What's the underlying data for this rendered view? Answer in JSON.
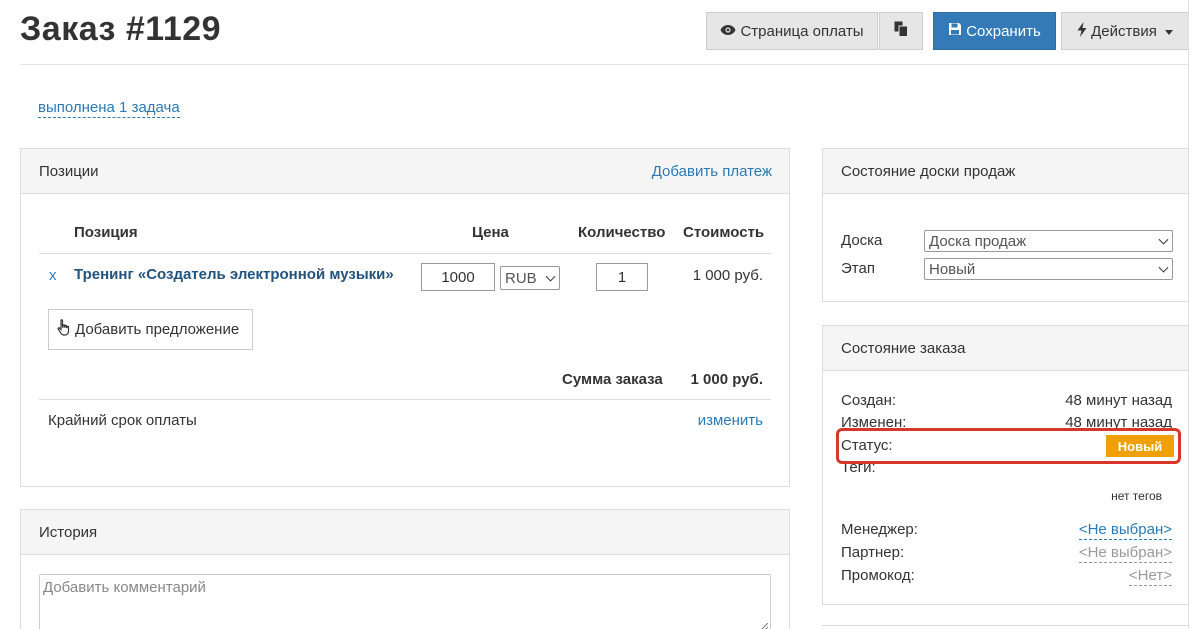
{
  "header": {
    "title": "Заказ #1129",
    "pay_page_label": "Страница оплаты",
    "save_label": "Сохранить",
    "actions_label": "Действия"
  },
  "task_link": "выполнена 1 задача",
  "positions": {
    "panel_title": "Позиции",
    "add_payment_label": "Добавить платеж",
    "columns": [
      "Позиция",
      "Цена",
      "Количество",
      "Стоимость"
    ],
    "rows": [
      {
        "remove": "x",
        "name": "Тренинг «Создатель электронной музыки»",
        "price": "1000",
        "currency": "RUB",
        "quantity": "1",
        "cost": "1 000 руб."
      }
    ],
    "add_offer_label": "Добавить предложение",
    "sum_label": "Сумма заказа",
    "sum_value": "1 000 руб.",
    "deadline_label": "Крайний срок оплаты",
    "change_label": "изменить"
  },
  "history": {
    "panel_title": "История",
    "comment_placeholder": "Добавить комментарий"
  },
  "sales_board": {
    "panel_title": "Состояние доски продаж",
    "board_label": "Доска",
    "board_value": "Доска продаж",
    "stage_label": "Этап",
    "stage_value": "Новый"
  },
  "order_state": {
    "panel_title": "Состояние заказа",
    "created_label": "Создан:",
    "created_value": "48 минут назад",
    "modified_label": "Изменен:",
    "modified_value": "48 минут назад",
    "status_label": "Статус:",
    "status_value": "Новый",
    "tags_label": "Теги:",
    "tags_value": "нет тегов",
    "manager_label": "Менеджер:",
    "manager_value": "<Не выбран>",
    "partner_label": "Партнер:",
    "partner_value": "<Не выбран>",
    "promo_label": "Промокод:",
    "promo_value": "<Нет>"
  },
  "colors": {
    "primary": "#337ab7",
    "link": "#2a7ab8",
    "status_new": "#f0a000",
    "highlight": "#d9362a"
  },
  "icons": {
    "pay_page": "eye-icon",
    "copy": "copy-icon",
    "save": "floppy-disk-icon",
    "actions": "lightning-icon",
    "add_offer": "hand-pointer-icon"
  }
}
